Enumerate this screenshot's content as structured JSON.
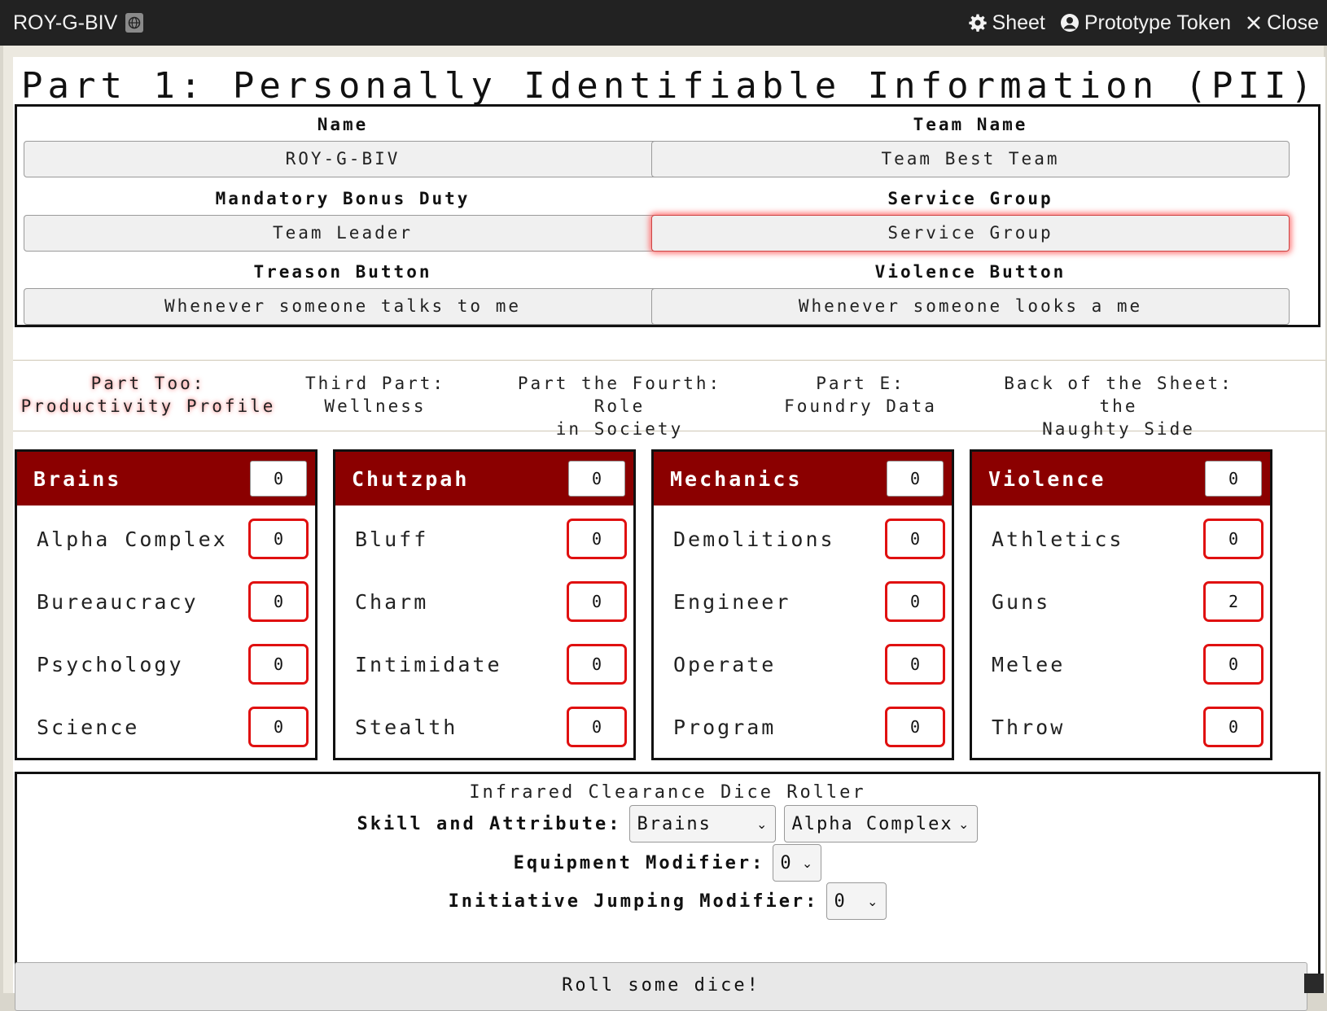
{
  "window": {
    "title": "ROY-G-BIV",
    "actions": [
      {
        "label": "Sheet",
        "icon": "gear-icon"
      },
      {
        "label": "Prototype Token",
        "icon": "user-circle-icon"
      },
      {
        "label": "Close",
        "icon": "close-icon"
      }
    ]
  },
  "part1": {
    "title": "Part 1: Personally Identifiable Information (PII)",
    "fields": {
      "name": {
        "label": "Name",
        "value": "ROY-G-BIV"
      },
      "team_name": {
        "label": "Team Name",
        "value": "Team Best Team"
      },
      "mbd": {
        "label": "Mandatory Bonus Duty",
        "value": "Team Leader"
      },
      "service_group": {
        "label": "Service Group",
        "value": "Service Group"
      },
      "treason": {
        "label": "Treason Button",
        "value": "Whenever someone talks to me"
      },
      "violence": {
        "label": "Violence Button",
        "value": "Whenever someone looks a me"
      }
    }
  },
  "tabs": [
    {
      "line1": "Part Too:",
      "line2": "Productivity Profile",
      "active": true
    },
    {
      "line1": "Third Part:",
      "line2": "Wellness"
    },
    {
      "line1": "Part the Fourth: Role",
      "line2": "in Society"
    },
    {
      "line1": "Part E:",
      "line2": "Foundry Data"
    },
    {
      "line1": "Back of the Sheet: the",
      "line2": "Naughty Side"
    }
  ],
  "attributes": [
    {
      "name": "Brains",
      "value": "0",
      "skills": [
        {
          "name": "Alpha Complex",
          "value": "0"
        },
        {
          "name": "Bureaucracy",
          "value": "0"
        },
        {
          "name": "Psychology",
          "value": "0"
        },
        {
          "name": "Science",
          "value": "0"
        }
      ]
    },
    {
      "name": "Chutzpah",
      "value": "0",
      "skills": [
        {
          "name": "Bluff",
          "value": "0"
        },
        {
          "name": "Charm",
          "value": "0"
        },
        {
          "name": "Intimidate",
          "value": "0"
        },
        {
          "name": "Stealth",
          "value": "0"
        }
      ]
    },
    {
      "name": "Mechanics",
      "value": "0",
      "skills": [
        {
          "name": "Demolitions",
          "value": "0"
        },
        {
          "name": "Engineer",
          "value": "0"
        },
        {
          "name": "Operate",
          "value": "0"
        },
        {
          "name": "Program",
          "value": "0"
        }
      ]
    },
    {
      "name": "Violence",
      "value": "0",
      "skills": [
        {
          "name": "Athletics",
          "value": "0"
        },
        {
          "name": "Guns",
          "value": "2"
        },
        {
          "name": "Melee",
          "value": "0"
        },
        {
          "name": "Throw",
          "value": "0"
        }
      ]
    }
  ],
  "roller": {
    "title": "Infrared Clearance Dice Roller",
    "skill_attr_label": "Skill and Attribute:",
    "attribute_selected": "Brains",
    "skill_selected": "Alpha Complex",
    "equipment_label": "Equipment Modifier:",
    "equipment_value": "0",
    "initiative_label": "Initiative Jumping Modifier:",
    "initiative_value": "0",
    "button_label": "Roll some dice!"
  },
  "colors": {
    "header_red": "#8b0000",
    "field_border_red": "#e01010",
    "titlebar": "#222222"
  }
}
